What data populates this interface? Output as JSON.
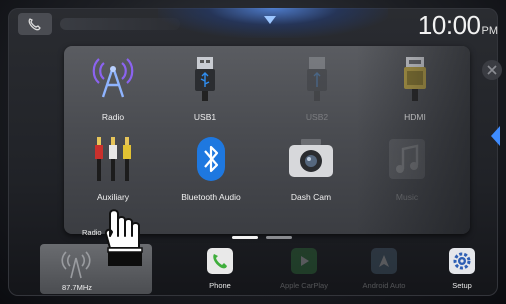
{
  "status_bar": {
    "time": "10:00",
    "ampm": "PM"
  },
  "menu": {
    "items": [
      {
        "label": "Radio",
        "icon": "radio-antenna-icon",
        "enabled": true
      },
      {
        "label": "USB1",
        "icon": "usb-icon",
        "enabled": true
      },
      {
        "label": "USB2",
        "icon": "usb-icon",
        "enabled": false
      },
      {
        "label": "HDMI",
        "icon": "hdmi-icon",
        "enabled": true
      },
      {
        "label": "Auxiliary",
        "icon": "rca-cables-icon",
        "enabled": true
      },
      {
        "label": "Bluetooth Audio",
        "icon": "bluetooth-icon",
        "enabled": true
      },
      {
        "label": "Dash Cam",
        "icon": "camera-icon",
        "enabled": true
      },
      {
        "label": "Music",
        "icon": "music-note-icon",
        "enabled": false
      }
    ],
    "page_indicator": {
      "pages": 2,
      "active": 1
    }
  },
  "dock": {
    "radio_label": "87.7MHz",
    "radio_sub_label": "Radio",
    "phone_label": "Phone",
    "apple_label": "Apple CarPlay",
    "android_label": "Android Auto",
    "setup_label": "Setup"
  },
  "colors": {
    "accent": "#3f8cff",
    "radio_icon": "#7b58e6",
    "bluetooth": "#1e78e0",
    "phone_green": "#3fae3c",
    "setup_blue": "#2e5fb4"
  }
}
